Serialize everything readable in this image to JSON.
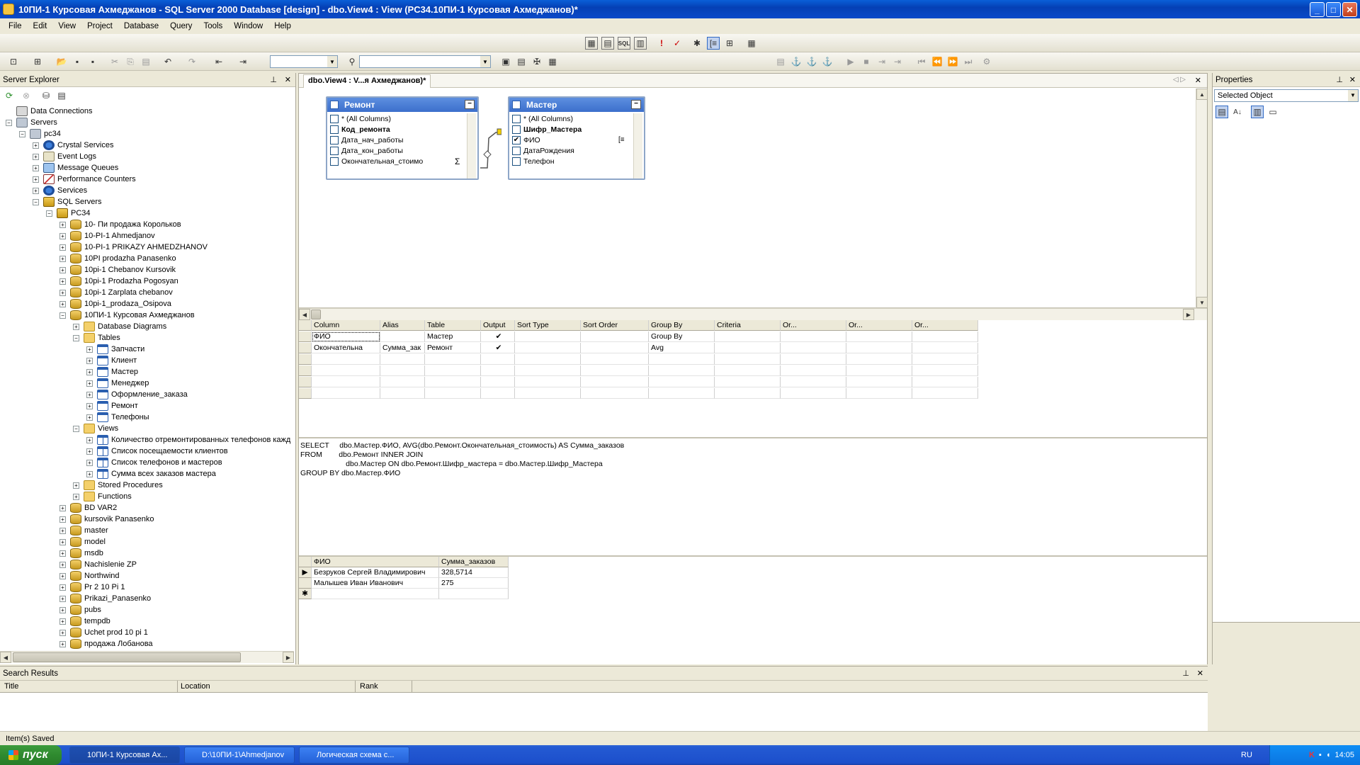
{
  "window": {
    "title": "10ПИ-1 Курсовая Ахмеджанов - SQL Server 2000 Database [design] - dbo.View4 : View (PC34.10ПИ-1 Курсовая Ахмеджанов)*",
    "minimize": "_",
    "maximize": "□",
    "close": "✕"
  },
  "menu": [
    "File",
    "Edit",
    "View",
    "Project",
    "Database",
    "Query",
    "Tools",
    "Window",
    "Help"
  ],
  "server_explorer": {
    "title": "Server Explorer",
    "nodes": [
      {
        "label": "Data Connections",
        "level": 0,
        "icon": "db-connection-icon",
        "exp": ""
      },
      {
        "label": "Servers",
        "level": 0,
        "icon": "servers-icon",
        "exp": "−"
      },
      {
        "label": "pc34",
        "level": 1,
        "icon": "server-icon",
        "exp": "−"
      },
      {
        "label": "Crystal Services",
        "level": 2,
        "icon": "crystal-services-icon",
        "exp": "+"
      },
      {
        "label": "Event Logs",
        "level": 2,
        "icon": "event-logs-icon",
        "exp": "+"
      },
      {
        "label": "Message Queues",
        "level": 2,
        "icon": "message-queues-icon",
        "exp": "+"
      },
      {
        "label": "Performance Counters",
        "level": 2,
        "icon": "performance-counters-icon",
        "exp": "+"
      },
      {
        "label": "Services",
        "level": 2,
        "icon": "services-icon",
        "exp": "+"
      },
      {
        "label": "SQL Servers",
        "level": 2,
        "icon": "sql-servers-icon",
        "exp": "−"
      },
      {
        "label": "PC34",
        "level": 3,
        "icon": "sql-server-instance-icon",
        "exp": "−"
      },
      {
        "label": "10- Пи продажа Корольков",
        "level": 4,
        "icon": "database-icon",
        "exp": "+"
      },
      {
        "label": "10-PI-1 Ahmedjanov",
        "level": 4,
        "icon": "database-icon",
        "exp": "+"
      },
      {
        "label": "10-PI-1 PRIKAZY AHMEDZHANOV",
        "level": 4,
        "icon": "database-icon",
        "exp": "+"
      },
      {
        "label": "10PI prodazha Panasenko",
        "level": 4,
        "icon": "database-icon",
        "exp": "+"
      },
      {
        "label": "10pi-1 Chebanov Kursovik",
        "level": 4,
        "icon": "database-icon",
        "exp": "+"
      },
      {
        "label": "10pi-1 Prodazha Pogosyan",
        "level": 4,
        "icon": "database-icon",
        "exp": "+"
      },
      {
        "label": "10pi-1 Zarplata chebanov",
        "level": 4,
        "icon": "database-icon",
        "exp": "+"
      },
      {
        "label": "10pi-1_prodaza_Osipova",
        "level": 4,
        "icon": "database-icon",
        "exp": "+"
      },
      {
        "label": "10ПИ-1 Курсовая Ахмеджанов",
        "level": 4,
        "icon": "database-icon",
        "exp": "−"
      },
      {
        "label": "Database Diagrams",
        "level": 5,
        "icon": "folder-icon",
        "exp": "+"
      },
      {
        "label": "Tables",
        "level": 5,
        "icon": "folder-icon",
        "exp": "−"
      },
      {
        "label": "Запчасти",
        "level": 6,
        "icon": "table-icon",
        "exp": "+"
      },
      {
        "label": "Клиент",
        "level": 6,
        "icon": "table-icon",
        "exp": "+"
      },
      {
        "label": "Мастер",
        "level": 6,
        "icon": "table-icon",
        "exp": "+"
      },
      {
        "label": "Менеджер",
        "level": 6,
        "icon": "table-icon",
        "exp": "+"
      },
      {
        "label": "Оформление_заказа",
        "level": 6,
        "icon": "table-icon",
        "exp": "+"
      },
      {
        "label": "Ремонт",
        "level": 6,
        "icon": "table-icon",
        "exp": "+"
      },
      {
        "label": "Телефоны",
        "level": 6,
        "icon": "table-icon",
        "exp": "+"
      },
      {
        "label": "Views",
        "level": 5,
        "icon": "folder-icon",
        "exp": "−"
      },
      {
        "label": "Количество отремонтированных телефонов кажд",
        "level": 6,
        "icon": "view-icon",
        "exp": "+"
      },
      {
        "label": "Список посещаемости клиентов",
        "level": 6,
        "icon": "view-icon",
        "exp": "+"
      },
      {
        "label": "Список телефонов и мастеров",
        "level": 6,
        "icon": "view-icon",
        "exp": "+"
      },
      {
        "label": "Сумма всех заказов мастера",
        "level": 6,
        "icon": "view-icon",
        "exp": "+"
      },
      {
        "label": "Stored Procedures",
        "level": 5,
        "icon": "folder-icon",
        "exp": "+"
      },
      {
        "label": "Functions",
        "level": 5,
        "icon": "folder-icon",
        "exp": "+"
      },
      {
        "label": "BD VAR2",
        "level": 4,
        "icon": "database-icon",
        "exp": "+"
      },
      {
        "label": "kursovik Panasenko",
        "level": 4,
        "icon": "database-icon",
        "exp": "+"
      },
      {
        "label": "master",
        "level": 4,
        "icon": "database-icon",
        "exp": "+"
      },
      {
        "label": "model",
        "level": 4,
        "icon": "database-icon",
        "exp": "+"
      },
      {
        "label": "msdb",
        "level": 4,
        "icon": "database-icon",
        "exp": "+"
      },
      {
        "label": "Nachislenie ZP",
        "level": 4,
        "icon": "database-icon",
        "exp": "+"
      },
      {
        "label": "Northwind",
        "level": 4,
        "icon": "database-icon",
        "exp": "+"
      },
      {
        "label": "Pr 2 10 Pi 1",
        "level": 4,
        "icon": "database-icon",
        "exp": "+"
      },
      {
        "label": "Prikazi_Panasenko",
        "level": 4,
        "icon": "database-icon",
        "exp": "+"
      },
      {
        "label": "pubs",
        "level": 4,
        "icon": "database-icon",
        "exp": "+"
      },
      {
        "label": "tempdb",
        "level": 4,
        "icon": "database-icon",
        "exp": "+"
      },
      {
        "label": "Uchet prod 10 pi 1",
        "level": 4,
        "icon": "database-icon",
        "exp": "+"
      },
      {
        "label": "продажа Лобанова",
        "level": 4,
        "icon": "database-icon",
        "exp": "+"
      }
    ]
  },
  "document": {
    "tab_label": "dbo.View4 : V...я Ахмеджанов)*",
    "tables": [
      {
        "title": "Ремонт",
        "columns": [
          {
            "name": "* (All Columns)",
            "checked": false,
            "bold": false
          },
          {
            "name": "Код_ремонта",
            "checked": false,
            "bold": true
          },
          {
            "name": "Дата_нач_работы",
            "checked": false,
            "bold": false
          },
          {
            "name": "Дата_кон_работы",
            "checked": false,
            "bold": false
          },
          {
            "name": "Окончательная_стоимо",
            "checked": false,
            "bold": false,
            "marker": "Σ"
          }
        ]
      },
      {
        "title": "Мастер",
        "columns": [
          {
            "name": "* (All Columns)",
            "checked": false,
            "bold": false
          },
          {
            "name": "Шифр_Мастера",
            "checked": false,
            "bold": true
          },
          {
            "name": "ФИО",
            "checked": true,
            "bold": false,
            "marker": "[≡"
          },
          {
            "name": "ДатаРождения",
            "checked": false,
            "bold": false
          },
          {
            "name": "Телефон",
            "checked": false,
            "bold": false
          }
        ]
      }
    ],
    "grid": {
      "headers": [
        "Column",
        "Alias",
        "Table",
        "Output",
        "Sort Type",
        "Sort Order",
        "Group By",
        "Criteria",
        "Or...",
        "Or...",
        "Or..."
      ],
      "rows": [
        [
          "ФИО",
          "",
          "Мастер",
          "✔",
          "",
          "",
          "Group By",
          "",
          "",
          "",
          ""
        ],
        [
          "Окончательна",
          "Сумма_зак",
          "Ремонт",
          "✔",
          "",
          "",
          "Avg",
          "",
          "",
          "",
          ""
        ]
      ]
    },
    "sql": "SELECT     dbo.Мастер.ФИО, AVG(dbo.Ремонт.Окончательная_стоимость) AS Сумма_заказов\nFROM        dbo.Ремонт INNER JOIN\n                      dbo.Мастер ON dbo.Ремонт.Шифр_мастера = dbo.Мастер.Шифр_Мастера\nGROUP BY dbo.Мастер.ФИО",
    "results": {
      "headers": [
        "ФИО",
        "Сумма_заказов"
      ],
      "rows": [
        [
          "Безруков Сергей Владимирович",
          "328,5714"
        ],
        [
          "Малышев Иван Иванович",
          "275"
        ]
      ],
      "new_row_marker": "✱"
    }
  },
  "properties": {
    "title": "Properties",
    "selected": "Selected Object"
  },
  "search_results": {
    "title": "Search Results",
    "columns": [
      "Title",
      "Location",
      "Rank"
    ]
  },
  "status": "Item(s) Saved",
  "taskbar": {
    "start": "пуск",
    "tasks": [
      "10ПИ-1 Курсовая Ах...",
      "D:\\10ПИ-1\\Ahmedjanov",
      "Логическая схема с..."
    ],
    "lang": "RU",
    "clock": "14:05"
  },
  "colors": {
    "titlebar": "#0b4ac8",
    "table_header": "#3c6fcc",
    "start_button": "#2f8a2f"
  }
}
